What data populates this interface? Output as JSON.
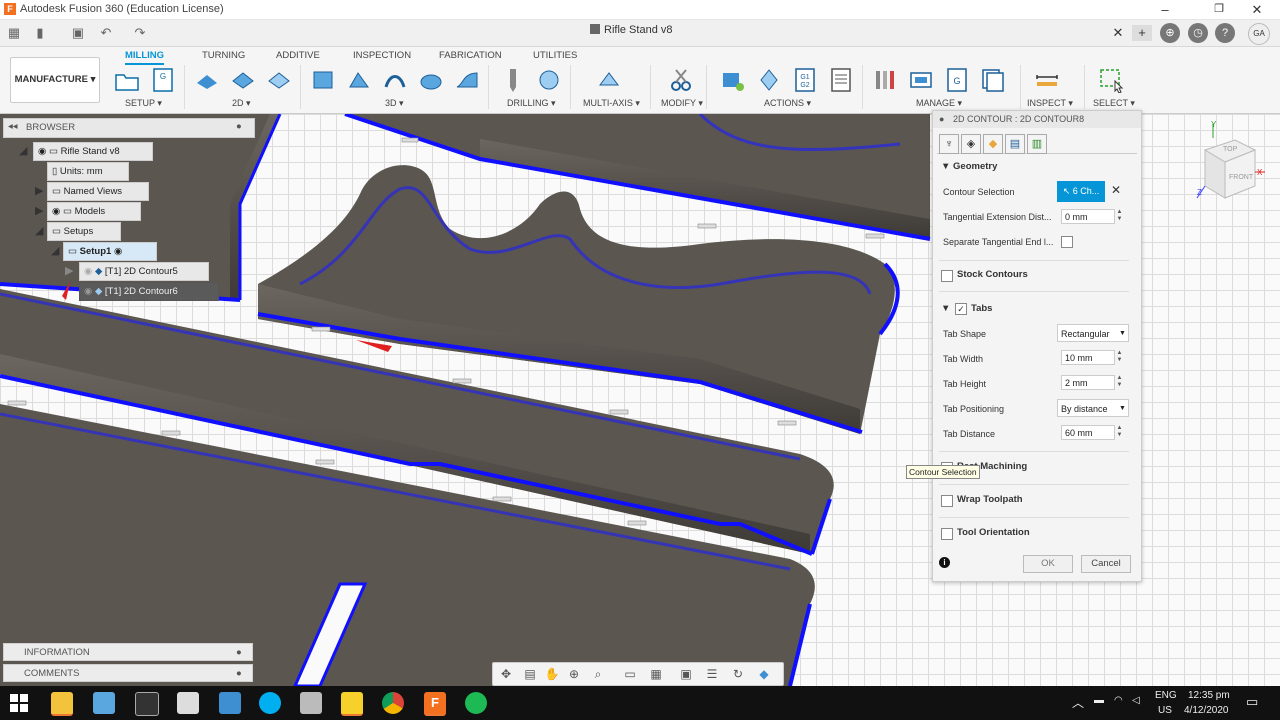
{
  "window": {
    "title": "Autodesk Fusion 360 (Education License)",
    "minimize": "–",
    "maximize": "❐",
    "close": "✕"
  },
  "qat": {
    "doc_title": "Rifle Stand v8",
    "close_tab": "✕",
    "new_tab": "+",
    "user_initials": "GA"
  },
  "ribbon": {
    "tabs": [
      "MILLING",
      "TURNING",
      "ADDITIVE",
      "INSPECTION",
      "FABRICATION",
      "UTILITIES"
    ],
    "active_tab": "MILLING",
    "workspace": "MANUFACTURE ▾",
    "groups": [
      "SETUP ▾",
      "2D ▾",
      "3D ▾",
      "DRILLING ▾",
      "MULTI-AXIS ▾",
      "MODIFY ▾",
      "ACTIONS ▾",
      "MANAGE ▾",
      "INSPECT ▾",
      "SELECT ▾"
    ]
  },
  "browser": {
    "header": "BROWSER",
    "root": "Rifle Stand v8",
    "units": "Units: mm",
    "named_views": "Named Views",
    "models": "Models",
    "setups": "Setups",
    "setup1": "Setup1",
    "op1": "[T1] 2D Contour5",
    "op2": "[T1] 2D Contour6"
  },
  "bottom_panels": {
    "information": "INFORMATION",
    "comments": "COMMENTS"
  },
  "dialog": {
    "title": "2D CONTOUR : 2D CONTOUR8",
    "geometry_section": "Geometry",
    "contour_selection_label": "Contour Selection",
    "contour_selection_value": "6 Ch...",
    "tangential_extension_label": "Tangential Extension Dist...",
    "tangential_extension_value": "0 mm",
    "separate_tangential_label": "Separate Tangential End l...",
    "stock_contours": "Stock Contours",
    "tabs_section": "Tabs",
    "tab_shape_label": "Tab Shape",
    "tab_shape_value": "Rectangular",
    "tab_width_label": "Tab Width",
    "tab_width_value": "10 mm",
    "tab_height_label": "Tab Height",
    "tab_height_value": "2 mm",
    "tab_positioning_label": "Tab Positioning",
    "tab_positioning_value": "By distance",
    "tab_distance_label": "Tab Distance",
    "tab_distance_value": "60 mm",
    "rest_machining": "Rest Machining",
    "wrap_toolpath": "Wrap Toolpath",
    "tool_orientation": "Tool Orientation",
    "ok": "OK",
    "cancel": "Cancel",
    "tooltip": "Contour Selection"
  },
  "viewcube": {
    "top": "TOP",
    "front": "FRONT",
    "x": "X",
    "y": "Y",
    "z": "Z"
  },
  "taskbar": {
    "lang1": "ENG",
    "lang2": "US",
    "time": "12:35 pm",
    "date": "4/12/2020"
  },
  "colors": {
    "accent": "#0696d7",
    "toolpath": "#1010ff",
    "part": "#5a5550"
  }
}
